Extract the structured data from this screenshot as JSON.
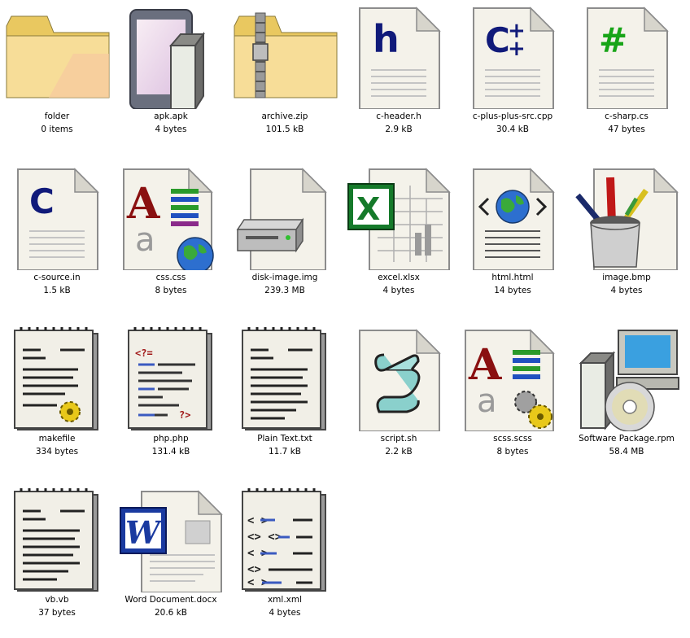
{
  "files": [
    {
      "name": "folder",
      "size": "0 items",
      "icon": "folder-icon"
    },
    {
      "name": "apk.apk",
      "size": "4 bytes",
      "icon": "android-package-icon"
    },
    {
      "name": "archive.zip",
      "size": "101.5 kB",
      "icon": "zip-folder-icon"
    },
    {
      "name": "c-header.h",
      "size": "2.9 kB",
      "icon": "c-header-icon"
    },
    {
      "name": "c-plus-plus-src.cpp",
      "size": "30.4 kB",
      "icon": "cpp-source-icon"
    },
    {
      "name": "c-sharp.cs",
      "size": "47 bytes",
      "icon": "csharp-source-icon"
    },
    {
      "name": "c-source.in",
      "size": "1.5 kB",
      "icon": "c-source-icon"
    },
    {
      "name": "css.css",
      "size": "8 bytes",
      "icon": "css-stylesheet-icon"
    },
    {
      "name": "disk-image.img",
      "size": "239.3 MB",
      "icon": "disk-image-icon"
    },
    {
      "name": "excel.xlsx",
      "size": "4 bytes",
      "icon": "excel-spreadsheet-icon"
    },
    {
      "name": "html.html",
      "size": "14 bytes",
      "icon": "html-document-icon"
    },
    {
      "name": "image.bmp",
      "size": "4 bytes",
      "icon": "image-paint-icon"
    },
    {
      "name": "makefile",
      "size": "334 bytes",
      "icon": "makefile-gear-icon"
    },
    {
      "name": "php.php",
      "size": "131.4 kB",
      "icon": "php-script-icon"
    },
    {
      "name": "Plain Text.txt",
      "size": "11.7 kB",
      "icon": "text-notepad-icon"
    },
    {
      "name": "script.sh",
      "size": "2.2 kB",
      "icon": "shell-script-scroll-icon"
    },
    {
      "name": "scss.scss",
      "size": "8 bytes",
      "icon": "scss-stylesheet-icon"
    },
    {
      "name": "Software Package.rpm",
      "size": "58.4 MB",
      "icon": "software-package-icon"
    },
    {
      "name": "vb.vb",
      "size": "37 bytes",
      "icon": "vb-source-notepad-icon"
    },
    {
      "name": "Word Document.docx",
      "size": "20.6 kB",
      "icon": "word-document-icon"
    },
    {
      "name": "xml.xml",
      "size": "4 bytes",
      "icon": "xml-notepad-icon"
    }
  ]
}
